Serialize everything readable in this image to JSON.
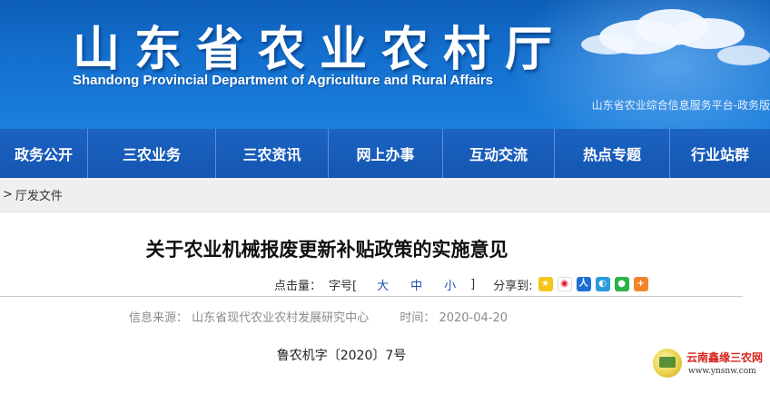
{
  "header": {
    "title": "山东省农业农村厅",
    "subtitle": "Shandong Provincial Department of Agriculture and Rural Affairs",
    "platform_link": "山东省农业综合信息服务平台-政务版"
  },
  "nav": {
    "items": [
      "政务公开",
      "三农业务",
      "三农资讯",
      "网上办事",
      "互动交流",
      "热点专题",
      "行业站群"
    ]
  },
  "breadcrumb": {
    "separator": ">",
    "current": "厅发文件"
  },
  "article": {
    "title": "关于农业机械报废更新补贴政策的实施意见",
    "tools": {
      "hits_label": "点击量：",
      "font_label": "字号[",
      "font_close": "]",
      "size_large": "大",
      "size_medium": "中",
      "size_small": "小",
      "share_label": "分享到:",
      "share_icons": [
        "qzone-icon",
        "weibo-icon",
        "renren-icon",
        "tqq-icon",
        "wechat-icon",
        "more-share-icon"
      ]
    },
    "meta": {
      "source_label": "信息来源：",
      "source": "山东省现代农业农村发展研究中心",
      "date_label": "时间：",
      "date": "2020-04-20"
    },
    "doc_number": "鲁农机字〔2020〕7号"
  },
  "watermark": {
    "name": "云南鑫缘三农网",
    "url": "www.ynsnw.com"
  },
  "colors": {
    "banner": "#1470cf",
    "nav": "#1a5dbd",
    "breadcrumb_bg": "#efefef",
    "font_size_link": "#1a4fb0",
    "meta_text": "#8a8a8a"
  }
}
